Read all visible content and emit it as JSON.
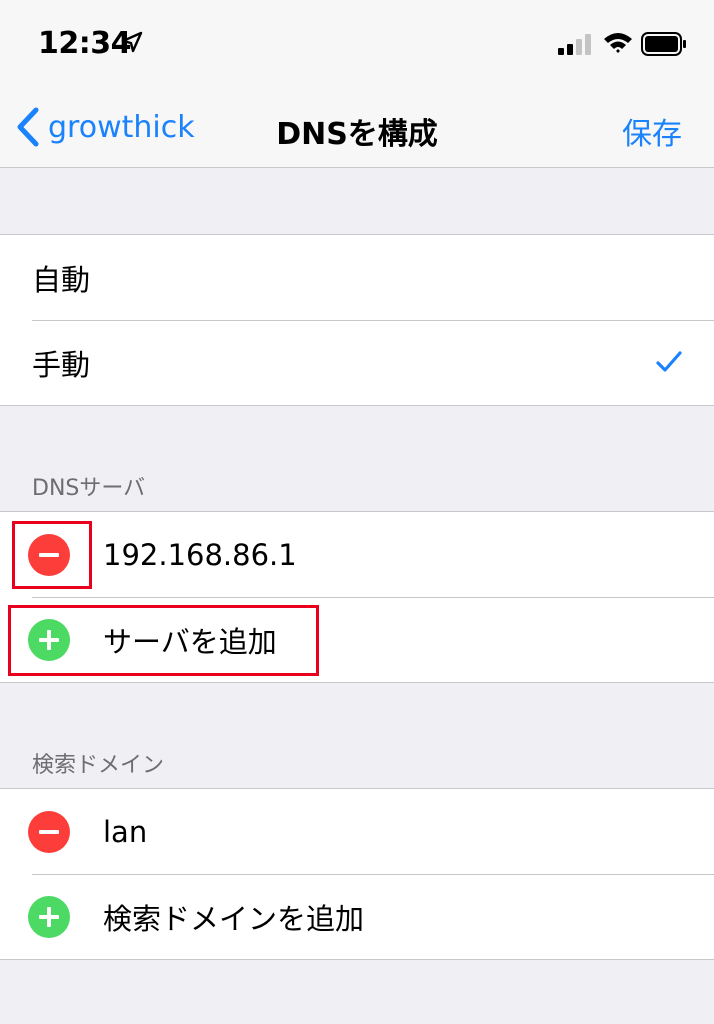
{
  "status_bar": {
    "time": "12:34",
    "icons": [
      "location-arrow-icon",
      "signal-icon",
      "wifi-icon",
      "battery-icon"
    ]
  },
  "nav_bar": {
    "back_label": "growthick",
    "title": "DNSを構成",
    "save_label": "保存"
  },
  "mode_group": {
    "items": [
      {
        "label": "自動",
        "checked": false
      },
      {
        "label": "手動",
        "checked": true
      }
    ]
  },
  "dns_servers": {
    "header": "DNSサーバ",
    "items": [
      {
        "value": "192.168.86.1",
        "action_icon": "remove-circle-icon"
      }
    ],
    "add_label": "サーバを追加"
  },
  "search_domains": {
    "header": "検索ドメイン",
    "items": [
      {
        "value": "lan",
        "action_icon": "remove-circle-icon"
      }
    ],
    "add_label": "検索ドメインを追加"
  },
  "colors": {
    "accent": "#1a82fb",
    "remove": "#fc3d39",
    "add": "#4cd964",
    "highlight": "#e8001c",
    "background": "#efeff4"
  }
}
